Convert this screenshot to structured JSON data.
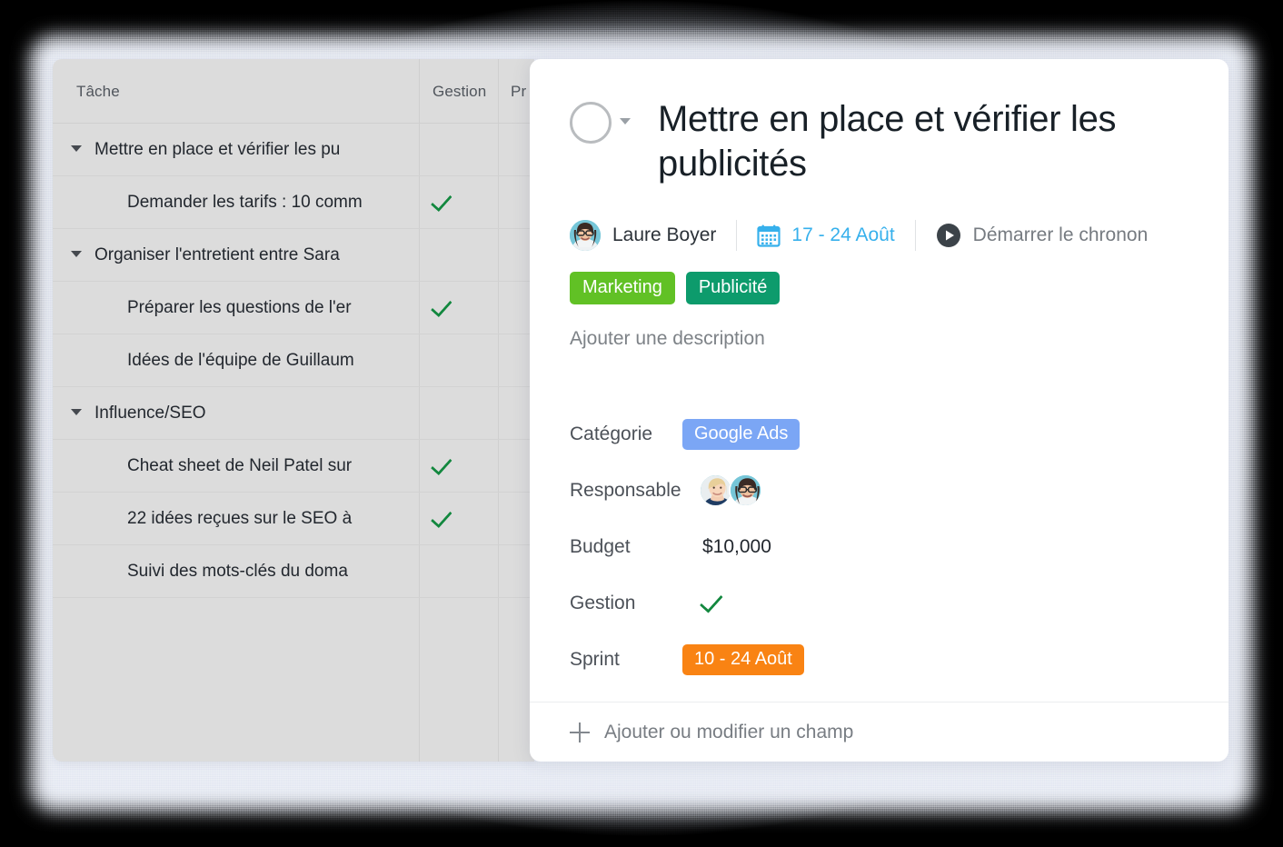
{
  "table": {
    "columns": [
      "Tâche",
      "Gestion",
      "Pr"
    ],
    "rows": [
      {
        "label": "Mettre en place et vérifier les pu",
        "type": "group",
        "gestion": false
      },
      {
        "label": "Demander les tarifs : 10 comm",
        "type": "child",
        "gestion": true
      },
      {
        "label": "Organiser l'entretient entre Sara",
        "type": "group",
        "gestion": false
      },
      {
        "label": "Préparer les questions de l'er",
        "type": "child",
        "gestion": true
      },
      {
        "label": "Idées de l'équipe de Guillaum",
        "type": "child",
        "gestion": false
      },
      {
        "label": "Influence/SEO",
        "type": "group",
        "gestion": false
      },
      {
        "label": "Cheat sheet de Neil Patel sur",
        "type": "child",
        "gestion": true
      },
      {
        "label": "22 idées reçues sur le SEO à",
        "type": "child",
        "gestion": true
      },
      {
        "label": "Suivi des mots-clés du doma",
        "type": "child",
        "gestion": false
      }
    ]
  },
  "detail": {
    "title": "Mettre en place et vérifier les publicités",
    "assignee": "Laure Boyer",
    "date_range": "17 - 24 Août",
    "timer_label": "Démarrer le chronon",
    "tags": [
      {
        "label": "Marketing",
        "color": "#61c125"
      },
      {
        "label": "Publicité",
        "color": "#0d9b6c"
      }
    ],
    "description_placeholder": "Ajouter une description",
    "fields": [
      {
        "label": "Catégorie",
        "kind": "pill",
        "value": "Google Ads",
        "color": "#7ba6f5"
      },
      {
        "label": "Responsable",
        "kind": "avatars",
        "value": ""
      },
      {
        "label": "Budget",
        "kind": "text",
        "value": "$10,000"
      },
      {
        "label": "Gestion",
        "kind": "check",
        "value": ""
      },
      {
        "label": "Sprint",
        "kind": "pill",
        "value": "10 - 24 Août",
        "color": "#f98313"
      }
    ],
    "add_field_label": "Ajouter ou modifier un champ"
  },
  "colors": {
    "accent_blue": "#36b0ec",
    "check_green": "#13883f",
    "tag_green": "#61c125",
    "tag_teal": "#0d9b6c",
    "tag_blue": "#7ba6f5",
    "tag_orange": "#f98313",
    "table_bg": "#dcdcdc",
    "panel_bg": "#ffffff"
  }
}
